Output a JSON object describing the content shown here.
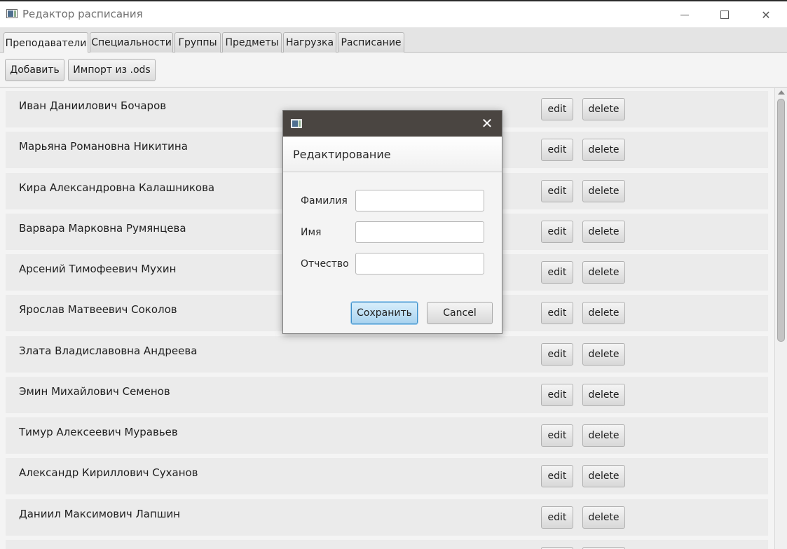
{
  "window": {
    "title": "Редактор расписания",
    "controls": {
      "minimize": "minimize",
      "maximize": "maximize",
      "close": "✕"
    }
  },
  "tabs": [
    {
      "label": "Преподаватели",
      "active": true
    },
    {
      "label": "Специальности",
      "active": false
    },
    {
      "label": "Группы",
      "active": false
    },
    {
      "label": "Предметы",
      "active": false
    },
    {
      "label": "Нагрузка",
      "active": false
    },
    {
      "label": "Расписание",
      "active": false
    }
  ],
  "toolbar": {
    "add_label": "Добавить",
    "import_label": "Импорт из .ods"
  },
  "teachers": {
    "edit_label": "edit",
    "delete_label": "delete",
    "rows": [
      "Иван Даниилович Бочаров",
      "Марьяна Романовна Никитина",
      "Кира Александровна Калашникова",
      "Варвара Марковна Румянцева",
      "Арсений Тимофеевич Мухин",
      "Ярослав Матвеевич Соколов",
      "Злата Владиславовна Андреева",
      "Эмин Михайлович Семенов",
      "Тимур Алексеевич Муравьев",
      "Александр Кириллович Суханов",
      "Даниил Максимович Лапшин",
      ""
    ]
  },
  "dialog": {
    "close": "✕",
    "heading": "Редактирование",
    "fields": {
      "last_name_label": "Фамилия",
      "last_name_value": "",
      "first_name_label": "Имя",
      "first_name_value": "",
      "patronymic_label": "Отчество",
      "patronymic_value": ""
    },
    "save_label": "Сохранить",
    "cancel_label": "Cancel"
  },
  "colors": {
    "dialog_titlebar": "#4a4541",
    "default_button_accent": "#a9d3ef",
    "row_background": "#ebebeb"
  }
}
